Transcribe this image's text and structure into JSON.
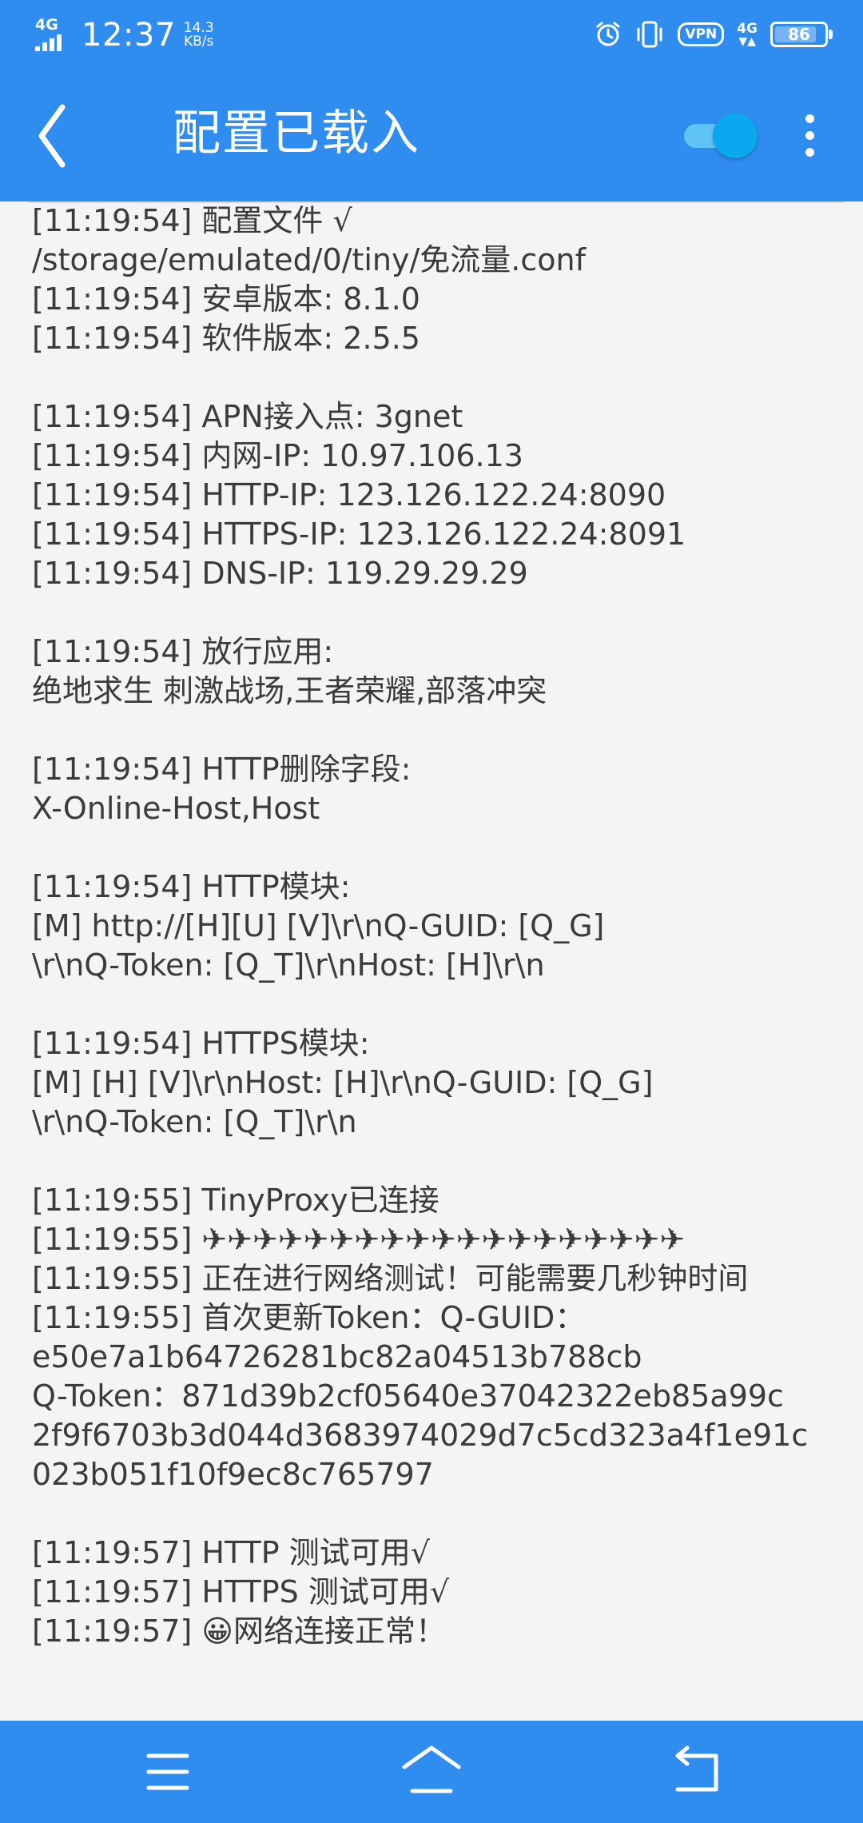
{
  "status_bar": {
    "network": "4G",
    "time": "12:37",
    "speed_value": "14.3",
    "speed_unit": "KB/s",
    "vpn": "VPN",
    "network_right": "4G",
    "battery": "86",
    "battery_level_percent": 86,
    "icons": [
      "signal-icon",
      "alarm-icon",
      "vibrate-icon",
      "vpn-icon",
      "data-arrows-icon",
      "battery-icon"
    ]
  },
  "toolbar": {
    "title": "配置已载入",
    "toggle_on": true,
    "icons": [
      "back-arrow-icon",
      "overflow-menu-icon"
    ]
  },
  "log": {
    "text": "[11:19:54] 配置文件 √\n/storage/emulated/0/tiny/免流量.conf\n[11:19:54] 安卓版本: 8.1.0\n[11:19:54] 软件版本: 2.5.5\n\n[11:19:54] APN接入点: 3gnet\n[11:19:54] 内网-IP: 10.97.106.13\n[11:19:54] HTTP-IP: 123.126.122.24:8090\n[11:19:54] HTTPS-IP: 123.126.122.24:8091\n[11:19:54] DNS-IP: 119.29.29.29\n\n[11:19:54] 放行应用:\n绝地求生 刺激战场,王者荣耀,部落冲突\n\n[11:19:54] HTTP删除字段:\nX-Online-Host,Host\n\n[11:19:54] HTTP模块:\n[M] http://[H][U] [V]\\r\\nQ-GUID: [Q_G]\n\\r\\nQ-Token: [Q_T]\\r\\nHost: [H]\\r\\n\n\n[11:19:54] HTTPS模块:\n[M] [H] [V]\\r\\nHost: [H]\\r\\nQ-GUID: [Q_G]\n\\r\\nQ-Token: [Q_T]\\r\\n\n\n[11:19:55] TinyProxy已连接\n[11:19:55] ✈✈✈✈✈✈✈✈✈✈✈✈✈✈✈✈✈✈✈\n[11:19:55] 正在进行网络测试！可能需要几秒钟时间\n[11:19:55] 首次更新Token：Q-GUID：\ne50e7a1b64726281bc82a04513b788cb\nQ-Token：871d39b2cf05640e37042322eb85a99c\n2f9f6703b3d044d3683974029d7c5cd323a4f1e91c\n023b051f10f9ec8c765797\n\n[11:19:57] HTTP 测试可用√\n[11:19:57] HTTPS 测试可用√\n[11:19:57] 😀网络连接正常！"
  },
  "nav_bar": {
    "icons": [
      "menu-lines-icon",
      "home-icon",
      "back-icon"
    ]
  },
  "colors": {
    "accent": "#2f8df0",
    "toggle_thumb": "#0aa8ef",
    "log_background": "#f4f4f4",
    "log_text": "#3b3b3b"
  }
}
